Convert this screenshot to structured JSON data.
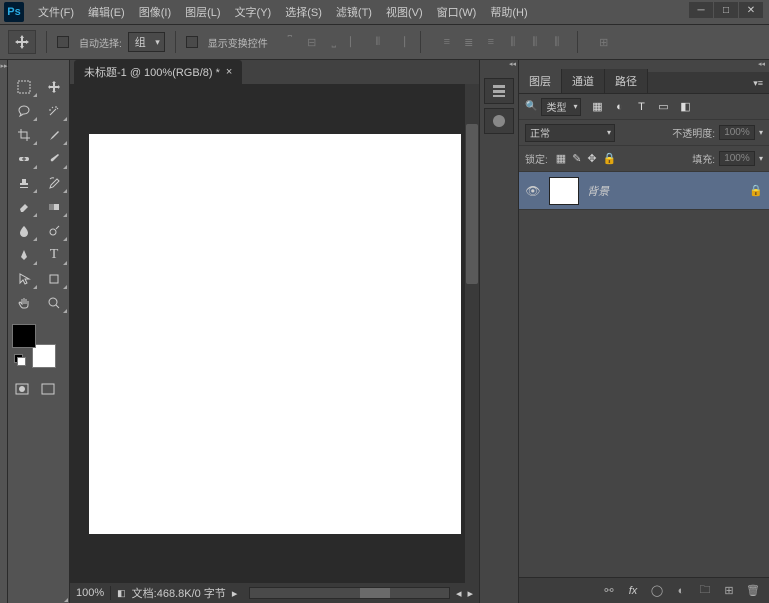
{
  "menubar": {
    "items": [
      "文件(F)",
      "编辑(E)",
      "图像(I)",
      "图层(L)",
      "文字(Y)",
      "选择(S)",
      "滤镜(T)",
      "视图(V)",
      "窗口(W)",
      "帮助(H)"
    ]
  },
  "optionsbar": {
    "auto_select": "自动选择:",
    "group": "组",
    "show_transform": "显示变换控件"
  },
  "document": {
    "tab_title": "未标题-1 @ 100%(RGB/8) *",
    "zoom": "100%",
    "status": "文档:468.8K/0 字节"
  },
  "layers_panel": {
    "tabs": {
      "layers": "图层",
      "channels": "通道",
      "paths": "路径"
    },
    "filter_label": "类型",
    "blend_mode": "正常",
    "opacity_label": "不透明度:",
    "opacity_value": "100%",
    "lock_label": "锁定:",
    "fill_label": "填充:",
    "fill_value": "100%",
    "layer_name": "背景"
  }
}
